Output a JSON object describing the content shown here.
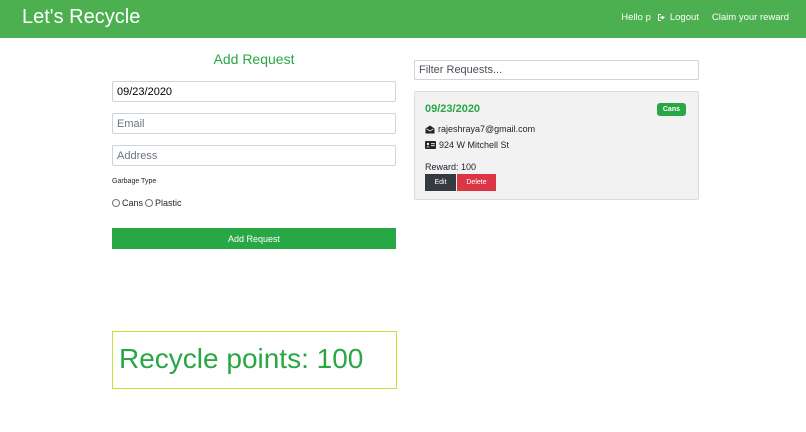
{
  "navbar": {
    "brand": "Let's Recycle",
    "greeting": "Hello p",
    "logout_label": "Logout",
    "claim_label": "Claim your reward",
    "bg_color": "#4caf50"
  },
  "form": {
    "title": "Add Request",
    "date_value": "09/23/2020",
    "email_placeholder": "Email",
    "address_placeholder": "Address",
    "garbage_type_label": "Garbage Type",
    "options": [
      "Cans",
      "Plastic"
    ],
    "submit_label": "Add Request"
  },
  "points": {
    "text": "Recycle points: 100"
  },
  "filter": {
    "placeholder": "Filter Requests..."
  },
  "requests": [
    {
      "date": "09/23/2020",
      "badge": "Cans",
      "email": "rajeshraya7@gmail.com",
      "address": "924 W Mitchell St",
      "reward": "Reward: 100",
      "edit_label": "Edit",
      "delete_label": "Delete"
    }
  ],
  "icons": {
    "logout": "sign-out-icon",
    "email": "envelope-open-icon",
    "address": "address-card-icon"
  },
  "colors": {
    "accent": "#28a745",
    "danger": "#dc3545",
    "dark": "#343a40",
    "points_border": "#cddc39"
  }
}
